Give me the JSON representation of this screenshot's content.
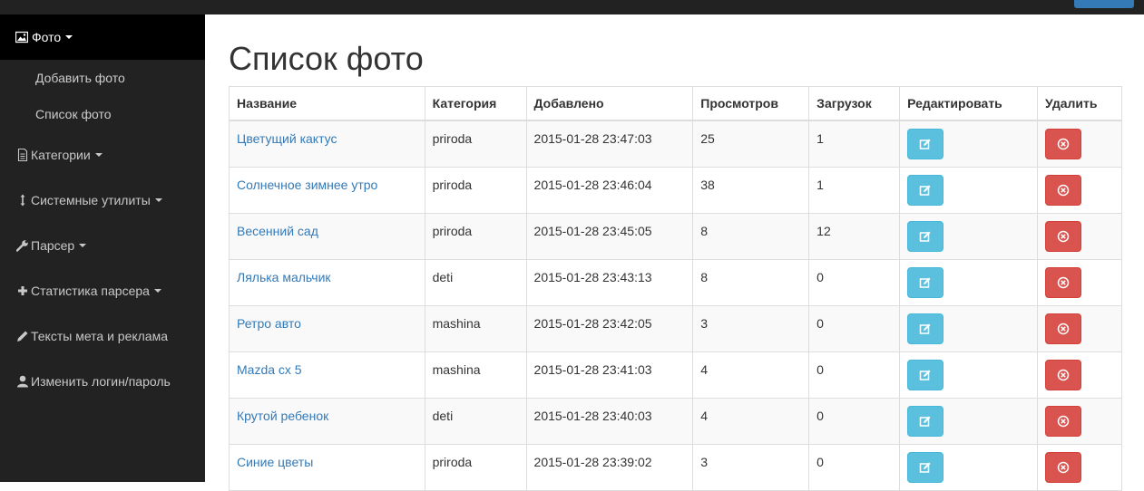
{
  "sidebar": {
    "header": {
      "label": "Фото",
      "icon": "picture-icon"
    },
    "sub_items": [
      {
        "label": "Добавить фото"
      },
      {
        "label": "Список фото"
      }
    ],
    "items": [
      {
        "label": "Категории",
        "icon": "file-icon",
        "has_caret": true
      },
      {
        "label": "Системные утилиты",
        "icon": "resize-vertical-icon",
        "has_caret": true
      },
      {
        "label": "Парсер",
        "icon": "wrench-icon",
        "has_caret": true
      },
      {
        "label": "Статистика парсера",
        "icon": "plus-icon",
        "has_caret": true
      },
      {
        "label": "Тексты мета и реклама",
        "icon": "pencil-icon",
        "has_caret": false
      },
      {
        "label": "Изменить логин/пароль",
        "icon": "user-icon",
        "has_caret": false
      }
    ]
  },
  "main": {
    "title": "Список фото",
    "table": {
      "headers": [
        "Название",
        "Категория",
        "Добавлено",
        "Просмотров",
        "Загрузок",
        "Редактировать",
        "Удалить"
      ],
      "rows": [
        {
          "name": "Цветущий кактус",
          "category": "priroda",
          "added": "2015-01-28 23:47:03",
          "views": "25",
          "downloads": "1"
        },
        {
          "name": "Солнечное зимнее утро",
          "category": "priroda",
          "added": "2015-01-28 23:46:04",
          "views": "38",
          "downloads": "1"
        },
        {
          "name": "Весенний сад",
          "category": "priroda",
          "added": "2015-01-28 23:45:05",
          "views": "8",
          "downloads": "12"
        },
        {
          "name": "Лялька мальчик",
          "category": "deti",
          "added": "2015-01-28 23:43:13",
          "views": "8",
          "downloads": "0"
        },
        {
          "name": "Ретро авто",
          "category": "mashina",
          "added": "2015-01-28 23:42:05",
          "views": "3",
          "downloads": "0"
        },
        {
          "name": "Mazda cx 5",
          "category": "mashina",
          "added": "2015-01-28 23:41:03",
          "views": "4",
          "downloads": "0"
        },
        {
          "name": "Крутой ребенок",
          "category": "deti",
          "added": "2015-01-28 23:40:03",
          "views": "4",
          "downloads": "0"
        },
        {
          "name": "Синие цветы",
          "category": "priroda",
          "added": "2015-01-28 23:39:02",
          "views": "3",
          "downloads": "0"
        }
      ]
    }
  },
  "colors": {
    "sidebar_bg": "#222222",
    "sidebar_active_bg": "#000000",
    "link": "#337ab7",
    "edit_button": "#5bc0de",
    "delete_button": "#d9534f"
  }
}
